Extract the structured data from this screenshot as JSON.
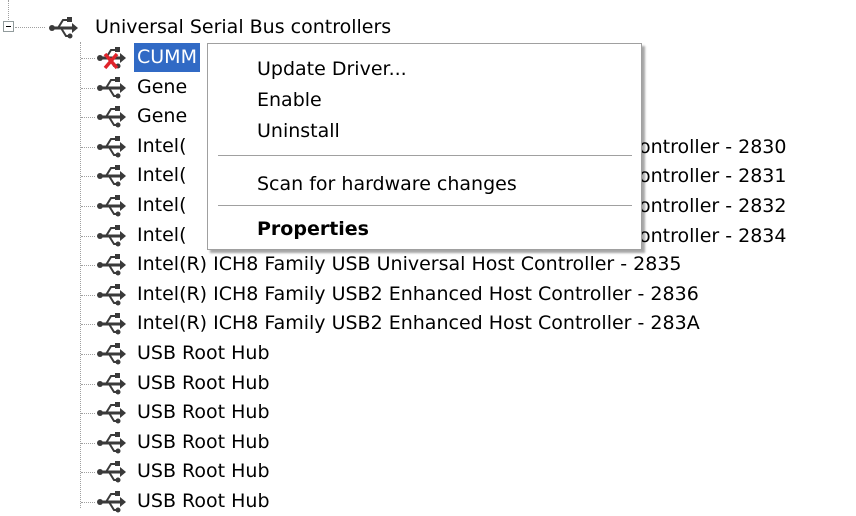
{
  "tree": {
    "category": {
      "label": "Universal Serial Bus controllers",
      "expanded": true,
      "icon": "usb-icon"
    },
    "devices": [
      {
        "label": "CUMM",
        "selected": true,
        "disabled": true,
        "icon": "usb-icon"
      },
      {
        "label": "Gene",
        "icon": "usb-icon"
      },
      {
        "label": "Gene",
        "icon": "usb-icon"
      },
      {
        "label": "Intel(",
        "icon": "usb-icon"
      },
      {
        "label": "Intel(",
        "icon": "usb-icon"
      },
      {
        "label": "Intel(",
        "icon": "usb-icon"
      },
      {
        "label": "Intel(",
        "icon": "usb-icon"
      },
      {
        "label": "Intel(R) ICH8 Family USB Universal Host Controller - 2835",
        "icon": "usb-icon"
      },
      {
        "label": "Intel(R) ICH8 Family USB2 Enhanced Host Controller - 2836",
        "icon": "usb-icon"
      },
      {
        "label": "Intel(R) ICH8 Family USB2 Enhanced Host Controller - 283A",
        "icon": "usb-icon"
      },
      {
        "label": "USB Root Hub",
        "icon": "usb-icon"
      },
      {
        "label": "USB Root Hub",
        "icon": "usb-icon"
      },
      {
        "label": "USB Root Hub",
        "icon": "usb-icon"
      },
      {
        "label": "USB Root Hub",
        "icon": "usb-icon"
      },
      {
        "label": "USB Root Hub",
        "icon": "usb-icon"
      },
      {
        "label": "USB Root Hub",
        "icon": "usb-icon"
      }
    ],
    "hidden_tails": [
      "ontroller - 2830",
      "ontroller - 2831",
      "ontroller - 2832",
      "ontroller - 2834"
    ]
  },
  "context_menu": {
    "items": [
      {
        "label": "Update Driver...",
        "bold": false
      },
      {
        "label": "Enable",
        "bold": false
      },
      {
        "label": "Uninstall",
        "bold": false
      },
      {
        "separator": true
      },
      {
        "label": "Scan for hardware changes",
        "bold": false
      },
      {
        "separator": true
      },
      {
        "label": "Properties",
        "bold": true
      }
    ]
  },
  "colors": {
    "selection": "#316ac5",
    "disabled_mark": "#e0242b",
    "usb_icon": "#3a3a3a"
  }
}
